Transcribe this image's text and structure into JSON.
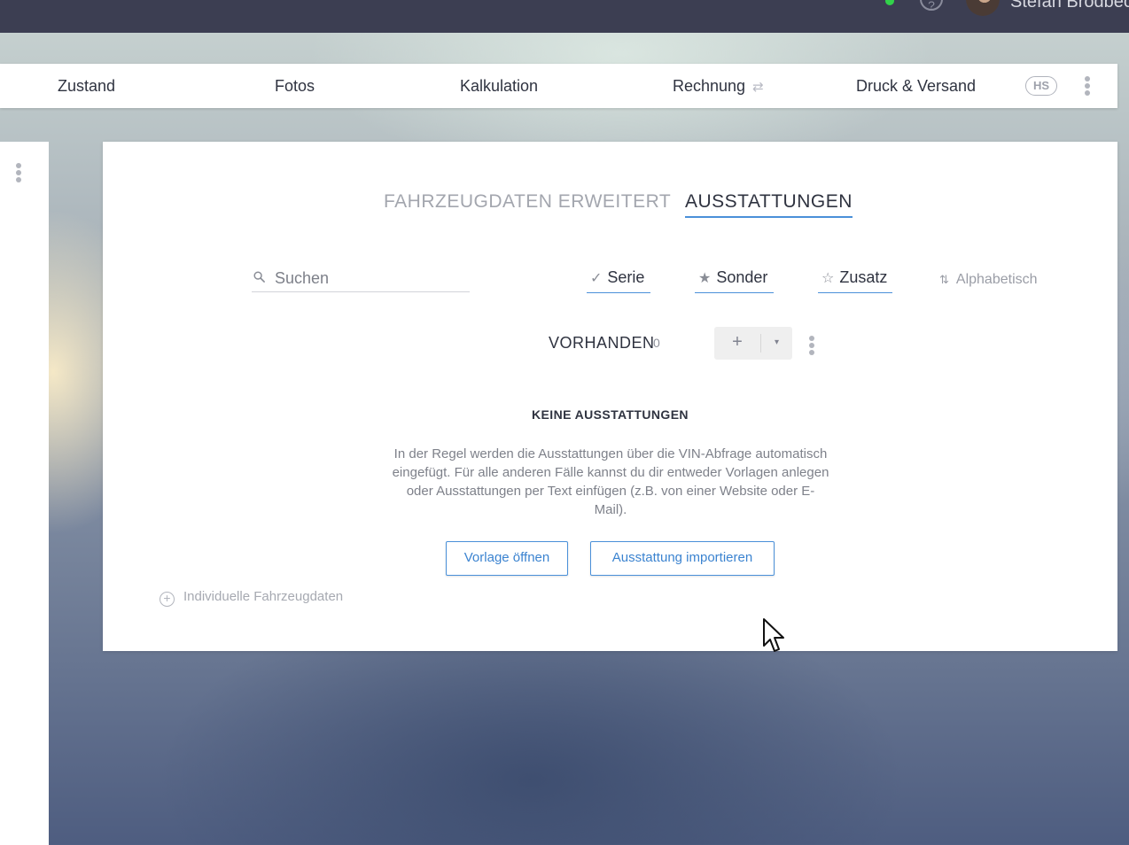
{
  "topbar": {
    "user_name": "Stefan Brodbeck",
    "help_glyph": "?"
  },
  "tabs": {
    "items": [
      "Zustand",
      "Fotos",
      "Kalkulation",
      "Rechnung",
      "Druck & Versand"
    ],
    "rechnung_icon": "⇄",
    "badge": "HS"
  },
  "card": {
    "section_tabs": {
      "inactive": "FAHRZEUGDATEN ERWEITERT",
      "active": "AUSSTATTUNGEN"
    },
    "search": {
      "placeholder": "Suchen",
      "value": ""
    },
    "filters": {
      "serie": {
        "icon": "✓",
        "label": "Serie"
      },
      "sonder": {
        "icon": "★",
        "label": "Sonder"
      },
      "zusatz": {
        "icon": "☆",
        "label": "Zusatz"
      }
    },
    "sort": {
      "icon": "⇅",
      "label": "Alphabetisch"
    },
    "vorhanden": {
      "label": "VORHANDEN",
      "count": "0",
      "add": "+",
      "caret": "▾"
    },
    "empty": {
      "title": "KEINE AUSSTATTUNGEN",
      "text": "In der Regel werden die Ausstattungen über die VIN-Abfrage automatisch eingefügt. Für alle anderen Fälle kannst du dir entweder Vorlagen anlegen oder Ausstattungen per Text einfügen (z.B. von einer Website oder E-Mail)."
    },
    "buttons": {
      "vorlage": "Vorlage öffnen",
      "import": "Ausstattung importieren"
    },
    "individual": {
      "icon": "+",
      "label": "Individuelle Fahrzeugdaten"
    }
  },
  "colors": {
    "accent": "#4a90d9",
    "topbar": "#3c3e52",
    "status_online": "#32d24a"
  }
}
